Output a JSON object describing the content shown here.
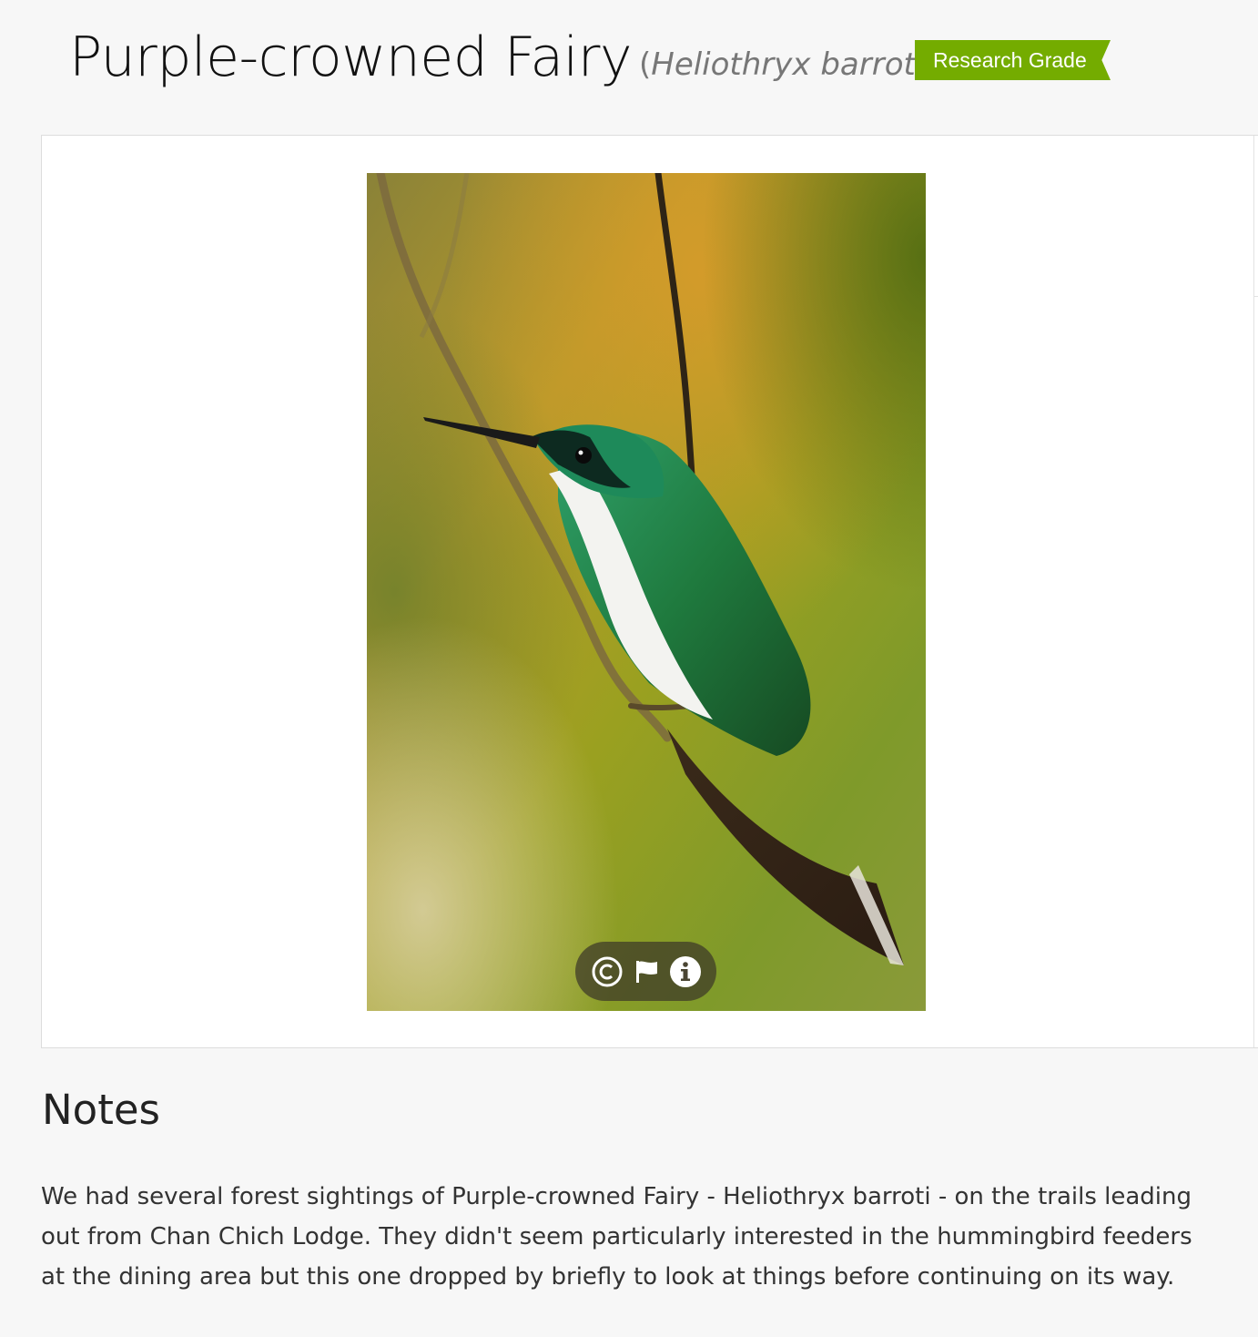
{
  "observation": {
    "common_name": "Purple-crowned Fairy",
    "scientific_name": "Heliothryx barroti",
    "paren_open": "(",
    "paren_close": ")",
    "quality_grade": "Research Grade",
    "quality_grade_color": "#74ac00"
  },
  "photo": {
    "subject": "hummingbird perched on a twig",
    "controls": [
      {
        "icon": "copyright-icon"
      },
      {
        "icon": "flag-icon"
      },
      {
        "icon": "info-icon"
      }
    ]
  },
  "notes": {
    "title": "Notes",
    "body": "We had several forest sightings of Purple-crowned Fairy - Heliothryx barroti - on the trails leading out from Chan Chich Lodge. They didn't seem particularly interested in the hummingbird feeders at the dining area but this one dropped by briefly to look at things before continuing on its way."
  }
}
